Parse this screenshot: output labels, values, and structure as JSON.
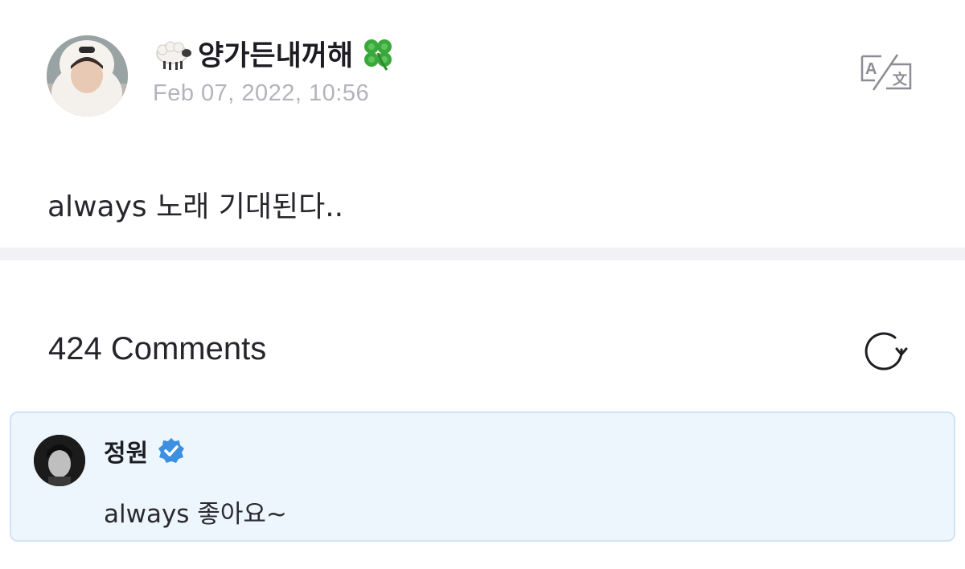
{
  "post": {
    "author": "양가든내꺼해",
    "author_prefix_icon": "sheep-emoji",
    "author_suffix_icon": "four-leaf-clover-emoji",
    "date": "Feb 07, 2022, 10:56",
    "body": "always 노래 기대된다..",
    "translate_icon": "translate-icon"
  },
  "comments": {
    "header": "424 Comments",
    "refresh_icon": "refresh-icon",
    "highlighted": {
      "author": "정원",
      "verified_icon": "verified-badge-icon",
      "text": "always 좋아요~"
    }
  },
  "colors": {
    "comment_bg": "#edf6fd",
    "comment_border": "#cfe3f4",
    "verified": "#3d8fe0",
    "date_gray": "#b3b3bb"
  }
}
